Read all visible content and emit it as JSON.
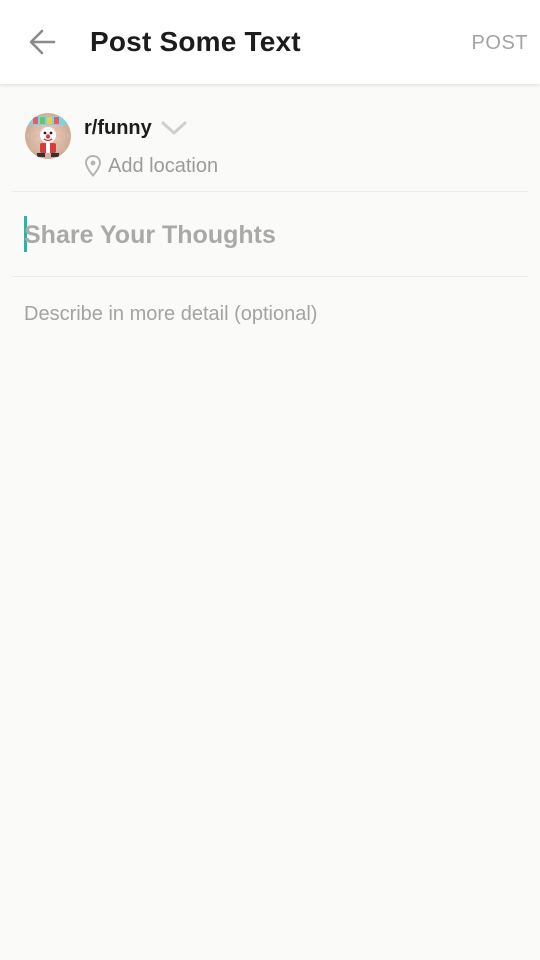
{
  "header": {
    "title": "Post Some Text",
    "post_label": "POST",
    "back_icon": "arrow-left-icon"
  },
  "community": {
    "name": "r/funny",
    "avatar_icon": "clown-avatar",
    "dropdown_icon": "chevron-down-icon",
    "location_icon": "map-pin-icon",
    "location_label": "Add location"
  },
  "form": {
    "title_placeholder": "Share Your Thoughts",
    "title_value": "",
    "body_placeholder": "Describe in more detail (optional)",
    "body_value": ""
  },
  "colors": {
    "accent_caret": "#26b5a6",
    "post_disabled": "#a3a3a3",
    "background": "#fafaf8"
  }
}
